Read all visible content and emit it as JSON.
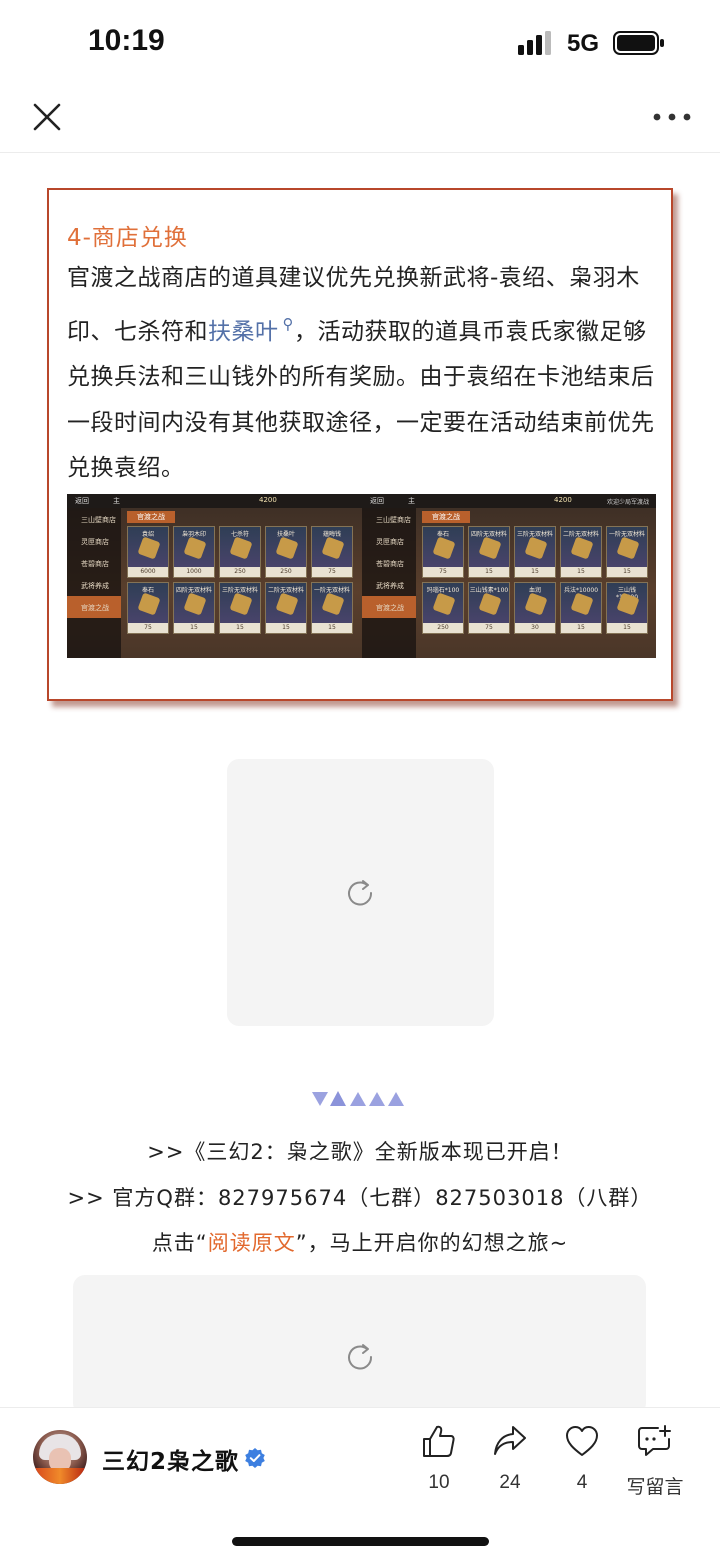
{
  "status_bar": {
    "time": "10:19",
    "network": "5G"
  },
  "nav": {
    "close_icon": "close-icon",
    "more_icon": "more-icon"
  },
  "article": {
    "section_title": "4-商店兑换",
    "paragraph_before": "官渡之战商店的道具建议优先兑换新武将-袁绍、枭羽木印、七杀符和",
    "link_text": "扶桑叶",
    "paragraph_after": "，活动获取的道具币袁氏家徽足够兑换兵法和三山钱外的所有奖励。由于袁绍在卡池结束后一段时间内没有其他获取途径，一定要在活动结束前优先兑换袁绍。",
    "image": {
      "top_bar": {
        "back": "返回",
        "home": "主",
        "currency": "4200",
        "right_note": "欢迎少局军渡战"
      },
      "left": {
        "sidebar": [
          "三山壁商店",
          "灵匣商店",
          "苍碧商店",
          "武将养成",
          "官渡之战"
        ],
        "tab": "官渡之战",
        "items": [
          {
            "name": "袁绍",
            "price": "6000"
          },
          {
            "name": "枭羽木印",
            "price": "1000"
          },
          {
            "name": "七杀符",
            "price": "250"
          },
          {
            "name": "扶桑叶",
            "price": "250"
          },
          {
            "name": "蕴晦钱",
            "price": "75"
          },
          {
            "name": "奉石",
            "price": "75"
          },
          {
            "name": "四阶无双材料自选",
            "price": "15"
          },
          {
            "name": "三阶无双材料自选",
            "price": "15"
          },
          {
            "name": "二阶无双材料自选",
            "price": "15"
          },
          {
            "name": "一阶无双材料自选",
            "price": "15"
          }
        ]
      },
      "right": {
        "sidebar": [
          "三山壁商店",
          "灵匣商店",
          "苍碧商店",
          "武将养成",
          "官渡之战"
        ],
        "tab": "官渡之战",
        "items": [
          {
            "name": "奉石",
            "price": "75"
          },
          {
            "name": "四阶无双材料自选",
            "price": "15"
          },
          {
            "name": "三阶无双材料自选",
            "price": "15"
          },
          {
            "name": "二阶无双材料自选",
            "price": "15"
          },
          {
            "name": "一阶无双材料自选",
            "price": "15"
          },
          {
            "name": "玛瑙石*100",
            "price": "250"
          },
          {
            "name": "三山钱素*100",
            "price": "75"
          },
          {
            "name": "血润",
            "price": "30"
          },
          {
            "name": "兵法*10000",
            "price": "15"
          },
          {
            "name": "三山钱*10000",
            "price": "15"
          }
        ]
      }
    }
  },
  "footer": {
    "line1": ">>《三幻2：枭之歌》全新版本现已开启！",
    "line2": ">> 官方Q群：827975674（七群）827503018（八群）",
    "line3_prefix": "点击“",
    "line3_link": "阅读原文",
    "line3_suffix": "”，马上开启你的幻想之旅~"
  },
  "bottom_bar": {
    "account_name": "三幻2枭之歌",
    "like_count": "10",
    "share_count": "24",
    "fav_count": "4",
    "comment_label": "写留言"
  },
  "colors": {
    "accent_orange": "#e0703a",
    "card_border": "#b8472b",
    "link_blue": "#5471a8",
    "verified_blue": "#3d7fe0"
  }
}
